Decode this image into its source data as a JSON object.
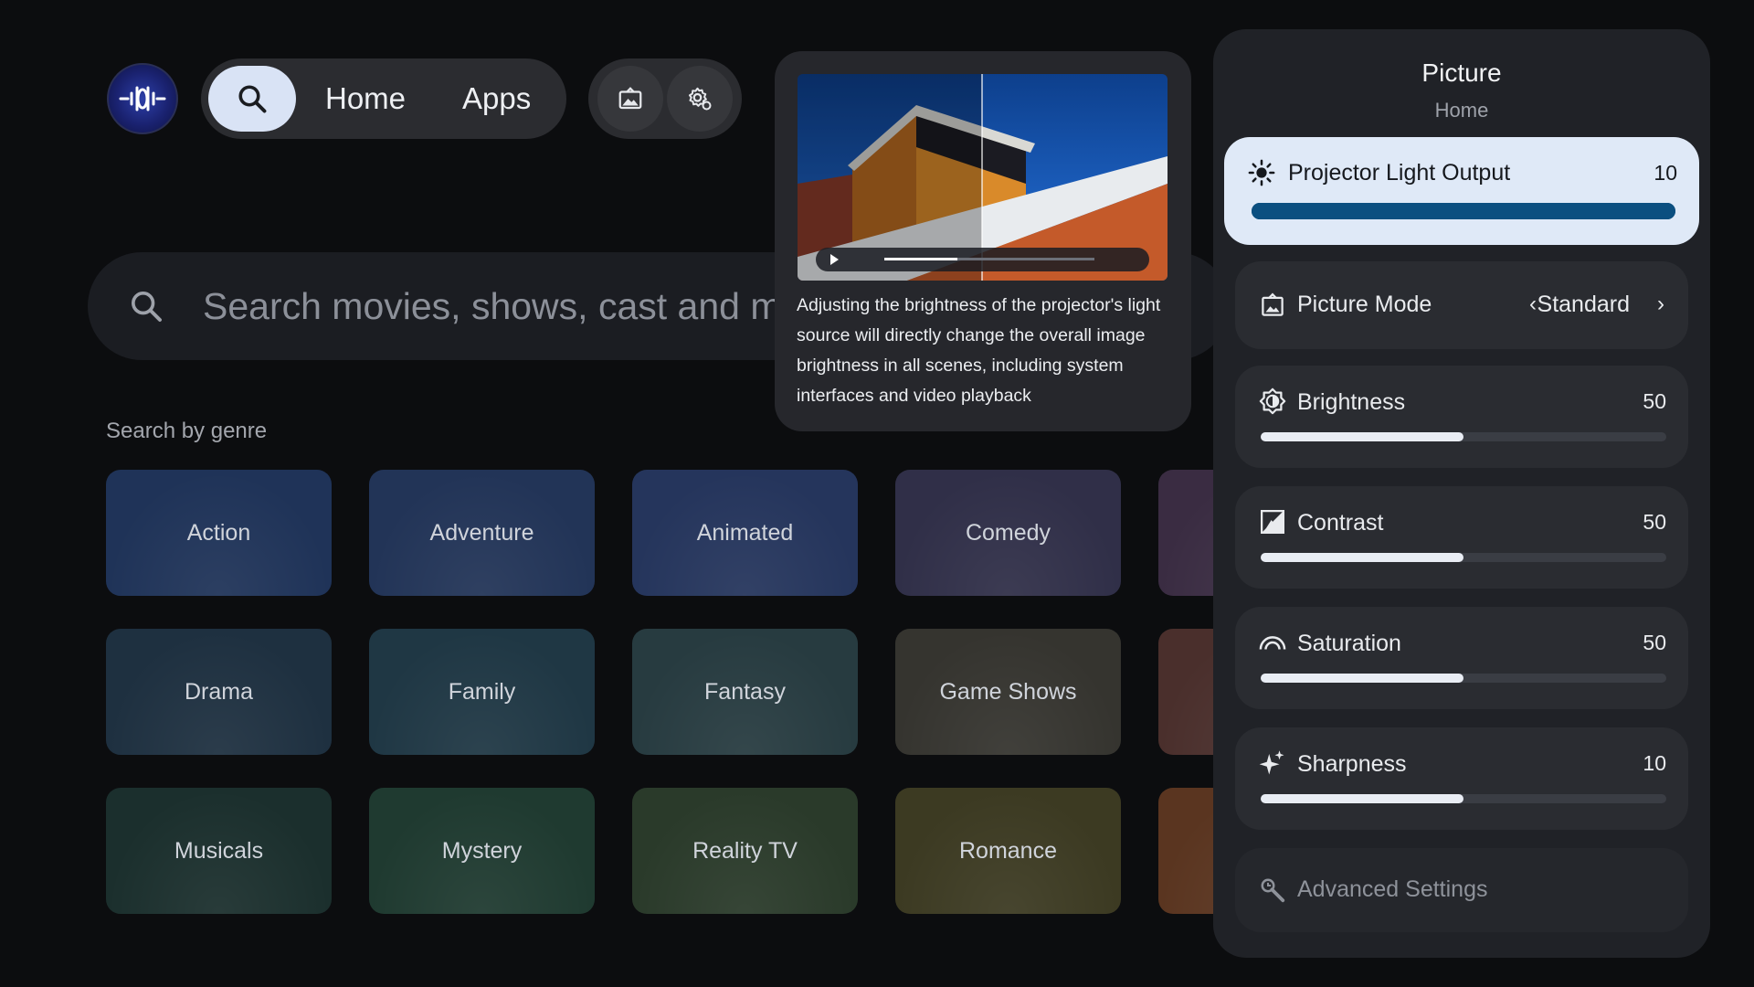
{
  "nav": {
    "home_label": "Home",
    "apps_label": "Apps",
    "icons": [
      "search-icon",
      "picture-icon",
      "settings-gear-icon"
    ]
  },
  "search": {
    "placeholder": "Search movies, shows, cast and m"
  },
  "genres": {
    "heading": "Search by genre",
    "items": [
      {
        "label": "Action",
        "color": "#1f3358"
      },
      {
        "label": "Adventure",
        "color": "#223457"
      },
      {
        "label": "Animated",
        "color": "#25355c"
      },
      {
        "label": "Comedy",
        "color": "#302f48"
      },
      {
        "label": "",
        "color": "#3a2c42"
      },
      {
        "label": "Drama",
        "color": "#1e3040"
      },
      {
        "label": "Family",
        "color": "#1f3744"
      },
      {
        "label": "Fantasy",
        "color": "#273b40"
      },
      {
        "label": "Game Shows",
        "color": "#35342f"
      },
      {
        "label": "",
        "color": "#4a2f2c"
      },
      {
        "label": "Musicals",
        "color": "#1b2f2d"
      },
      {
        "label": "Mystery",
        "color": "#1f3a30"
      },
      {
        "label": "Reality TV",
        "color": "#2a3a2a"
      },
      {
        "label": "Romance",
        "color": "#3c3a22"
      },
      {
        "label": "",
        "color": "#5a3520"
      }
    ]
  },
  "preview": {
    "description": "Adjusting the brightness of the projector's light source will directly change the overall image brightness in all scenes, including system interfaces and video playback"
  },
  "panel": {
    "title": "Picture",
    "subtitle": "Home",
    "light_output": {
      "label": "Projector Light Output",
      "value": "10",
      "level": 1.0
    },
    "picture_mode": {
      "label": "Picture Mode",
      "value": "Standard"
    },
    "brightness": {
      "label": "Brightness",
      "value": "50",
      "level": 0.5
    },
    "contrast": {
      "label": "Contrast",
      "value": "50",
      "level": 0.5
    },
    "saturation": {
      "label": "Saturation",
      "value": "50",
      "level": 0.5
    },
    "sharpness": {
      "label": "Sharpness",
      "value": "10",
      "level": 0.5
    },
    "advanced": {
      "label": "Advanced Settings"
    }
  }
}
